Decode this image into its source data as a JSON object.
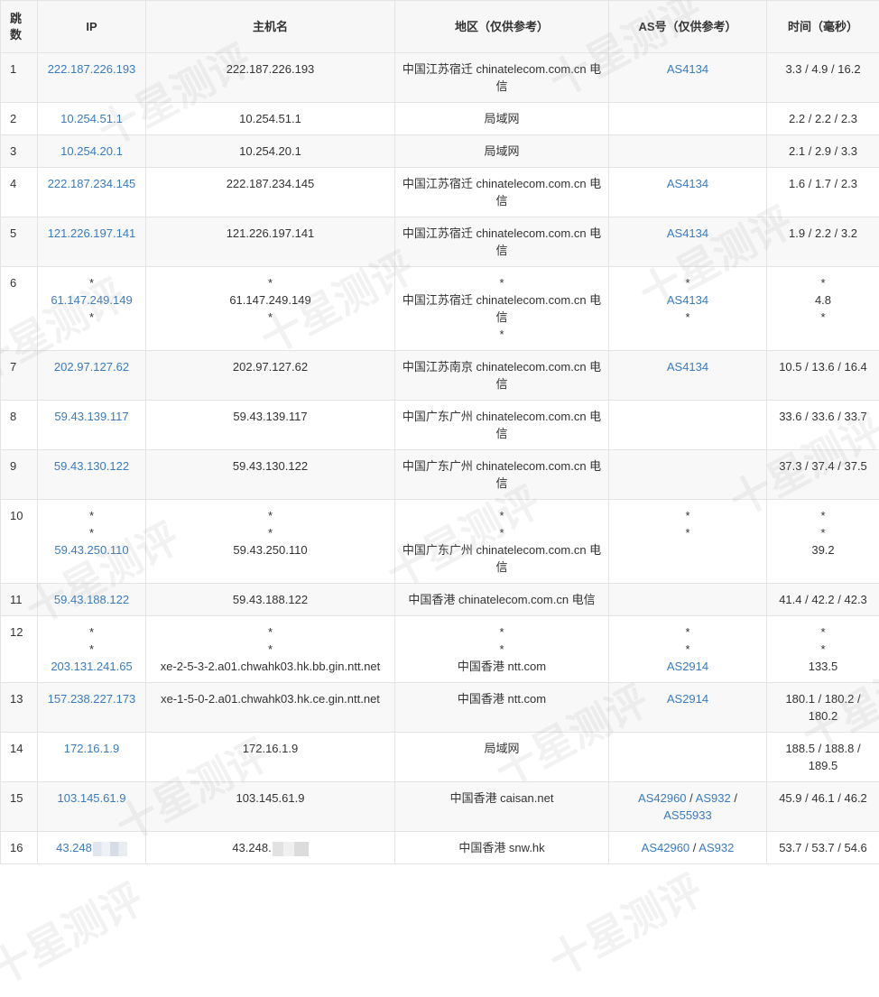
{
  "headers": {
    "hop": "跳数",
    "ip": "IP",
    "host": "主机名",
    "region": "地区（仅供参考）",
    "as": "AS号（仅供参考）",
    "time": "时间（毫秒）"
  },
  "watermark": "十星测评",
  "rows": [
    {
      "hop": "1",
      "ip": [
        "222.187.226.193"
      ],
      "host": [
        "222.187.226.193"
      ],
      "region": [
        "中国江苏宿迁 chinatelecom.com.cn 电信"
      ],
      "as": [
        [
          "AS4134"
        ]
      ],
      "time": [
        "3.3 / 4.9 / 16.2"
      ]
    },
    {
      "hop": "2",
      "ip": [
        "10.254.51.1"
      ],
      "host": [
        "10.254.51.1"
      ],
      "region": [
        "局域网"
      ],
      "as": [],
      "time": [
        "2.2 / 2.2 / 2.3"
      ]
    },
    {
      "hop": "3",
      "ip": [
        "10.254.20.1"
      ],
      "host": [
        "10.254.20.1"
      ],
      "region": [
        "局域网"
      ],
      "as": [],
      "time": [
        "2.1 / 2.9 / 3.3"
      ]
    },
    {
      "hop": "4",
      "ip": [
        "222.187.234.145"
      ],
      "host": [
        "222.187.234.145"
      ],
      "region": [
        "中国江苏宿迁 chinatelecom.com.cn 电信"
      ],
      "as": [
        [
          "AS4134"
        ]
      ],
      "time": [
        "1.6 / 1.7 / 2.3"
      ]
    },
    {
      "hop": "5",
      "ip": [
        "121.226.197.141"
      ],
      "host": [
        "121.226.197.141"
      ],
      "region": [
        "中国江苏宿迁 chinatelecom.com.cn 电信"
      ],
      "as": [
        [
          "AS4134"
        ]
      ],
      "time": [
        "1.9 / 2.2 / 3.2"
      ]
    },
    {
      "hop": "6",
      "ip": [
        "*",
        "61.147.249.149",
        "*"
      ],
      "host": [
        "*",
        "61.147.249.149",
        "*"
      ],
      "region": [
        "*",
        "中国江苏宿迁 chinatelecom.com.cn 电信",
        "*"
      ],
      "as": [
        [
          "*"
        ],
        [
          "AS4134"
        ],
        [
          "*"
        ]
      ],
      "time": [
        "*",
        "4.8",
        "*"
      ]
    },
    {
      "hop": "7",
      "ip": [
        "202.97.127.62"
      ],
      "host": [
        "202.97.127.62"
      ],
      "region": [
        "中国江苏南京 chinatelecom.com.cn 电信"
      ],
      "as": [
        [
          "AS4134"
        ]
      ],
      "time": [
        "10.5 / 13.6 / 16.4"
      ]
    },
    {
      "hop": "8",
      "ip": [
        "59.43.139.117"
      ],
      "host": [
        "59.43.139.117"
      ],
      "region": [
        "中国广东广州 chinatelecom.com.cn 电信"
      ],
      "as": [],
      "time": [
        "33.6 / 33.6 / 33.7"
      ]
    },
    {
      "hop": "9",
      "ip": [
        "59.43.130.122"
      ],
      "host": [
        "59.43.130.122"
      ],
      "region": [
        "中国广东广州 chinatelecom.com.cn 电信"
      ],
      "as": [],
      "time": [
        "37.3 / 37.4 / 37.5"
      ]
    },
    {
      "hop": "10",
      "ip": [
        "*",
        "*",
        "59.43.250.110"
      ],
      "host": [
        "*",
        "*",
        "59.43.250.110"
      ],
      "region": [
        "*",
        "*",
        "中国广东广州 chinatelecom.com.cn 电信"
      ],
      "as": [
        [
          "*"
        ],
        [
          "*"
        ]
      ],
      "time": [
        "*",
        "*",
        "39.2"
      ]
    },
    {
      "hop": "11",
      "ip": [
        "59.43.188.122"
      ],
      "host": [
        "59.43.188.122"
      ],
      "region": [
        "中国香港 chinatelecom.com.cn 电信"
      ],
      "as": [],
      "time": [
        "41.4 / 42.2 / 42.3"
      ]
    },
    {
      "hop": "12",
      "ip": [
        "*",
        "*",
        "203.131.241.65"
      ],
      "host": [
        "*",
        "*",
        "xe-2-5-3-2.a01.chwahk03.hk.bb.gin.ntt.net"
      ],
      "region": [
        "*",
        "*",
        "中国香港 ntt.com"
      ],
      "as": [
        [
          "*"
        ],
        [
          "*"
        ],
        [
          "AS2914"
        ]
      ],
      "time": [
        "*",
        "*",
        "133.5"
      ]
    },
    {
      "hop": "13",
      "ip": [
        "157.238.227.173"
      ],
      "host": [
        "xe-1-5-0-2.a01.chwahk03.hk.ce.gin.ntt.net"
      ],
      "region": [
        "中国香港 ntt.com"
      ],
      "as": [
        [
          "AS2914"
        ]
      ],
      "time": [
        "180.1 / 180.2 / 180.2"
      ]
    },
    {
      "hop": "14",
      "ip": [
        "172.16.1.9"
      ],
      "host": [
        "172.16.1.9"
      ],
      "region": [
        "局域网"
      ],
      "as": [],
      "time": [
        "188.5 / 188.8 / 189.5"
      ]
    },
    {
      "hop": "15",
      "ip": [
        "103.145.61.9"
      ],
      "host": [
        "103.145.61.9"
      ],
      "region": [
        "中国香港 caisan.net"
      ],
      "as": [
        [
          "AS42960",
          "AS932",
          "AS55933"
        ]
      ],
      "time": [
        "45.9 / 46.1 / 46.2"
      ]
    },
    {
      "hop": "16",
      "ip": [
        "43.248"
      ],
      "host": [
        "43.248."
      ],
      "region": [
        "中国香港 snw.hk"
      ],
      "as": [
        [
          "AS42960",
          "AS932"
        ]
      ],
      "time": [
        "53.7 / 53.7 / 54.6"
      ],
      "ip_masked": true,
      "host_masked": true
    }
  ]
}
